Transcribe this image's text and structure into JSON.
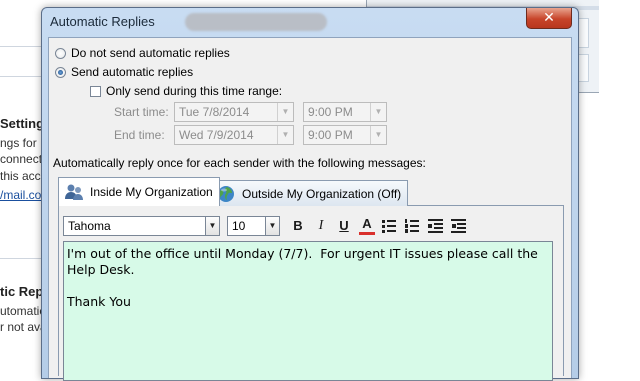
{
  "background": {
    "settings_heading": "Setting",
    "lines": [
      "ngs for",
      "connect",
      "this acc"
    ],
    "link": "/mail.co",
    "auto_heading": "tic Replie",
    "auto_lines": [
      "utomatic repl",
      "r not ava"
    ]
  },
  "dialog": {
    "title": "Automatic Replies",
    "close_glyph": "✕"
  },
  "options": {
    "do_not_send": "Do not send automatic replies",
    "send": "Send automatic replies",
    "selected": "send",
    "time_range_label": "Only send during this time range:",
    "time_range_checked": false,
    "start_label": "Start time:",
    "start_date": "Tue 7/8/2014",
    "start_time": "9:00 PM",
    "end_label": "End time:",
    "end_date": "Wed 7/9/2014",
    "end_time": "9:00 PM"
  },
  "reply_instruction": "Automatically reply once for each sender with the following messages:",
  "tabs": [
    {
      "label": "Inside My Organization",
      "active": true,
      "icon": "people-icon"
    },
    {
      "label": "Outside My Organization (Off)",
      "active": false,
      "icon": "globe-icon"
    }
  ],
  "toolbar": {
    "font": "Tahoma",
    "size": "10",
    "bold": "B",
    "italic": "I",
    "underline": "U",
    "font_color": "A",
    "font_color_accent": "#d9302c"
  },
  "message": {
    "text": "I'm out of the office until Monday (7/7).  For urgent IT issues please call the Help Desk.\n\nThank You"
  },
  "colors": {
    "editor_background": "#d7fae8",
    "close_button": "#c7442a"
  }
}
